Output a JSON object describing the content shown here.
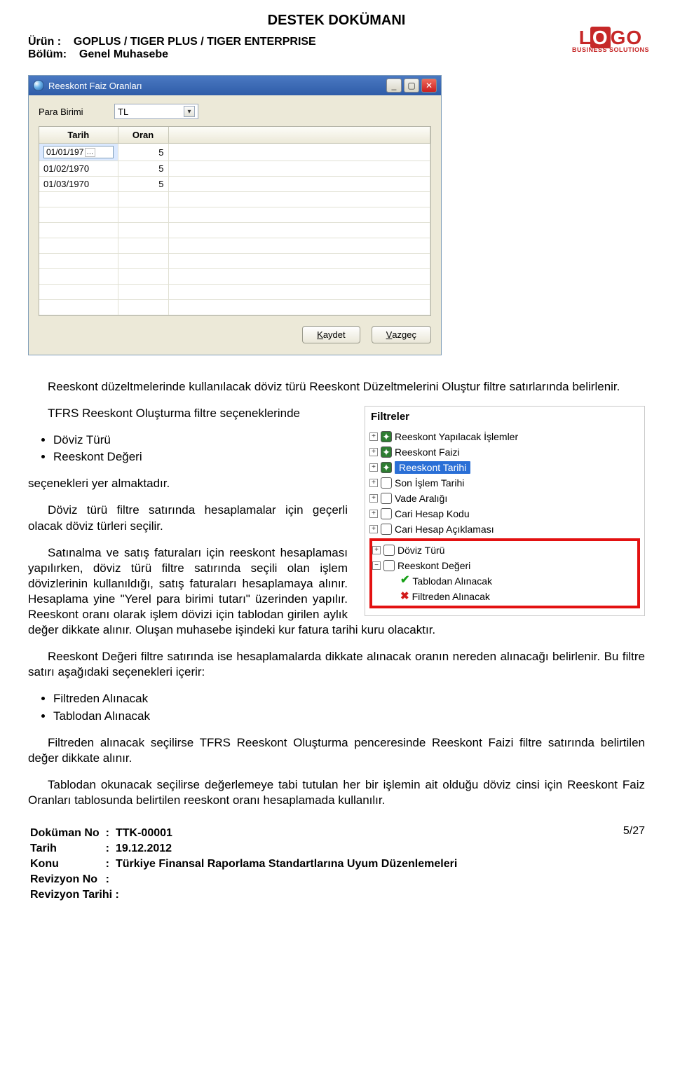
{
  "header": {
    "doc_title": "DESTEK DOKÜMANI",
    "product_label": "Ürün  :",
    "product_value": "GOPLUS / TIGER PLUS / TIGER ENTERPRISE",
    "section_label": "Bölüm:",
    "section_value": "Genel Muhasebe",
    "logo_text": "LOGO",
    "logo_sub": "BUSINESS SOLUTIONS"
  },
  "window": {
    "title": "Reeskont Faiz Oranları",
    "param_label": "Para Birimi",
    "param_value": "TL",
    "col1": "Tarih",
    "col2": "Oran",
    "rows": [
      {
        "date": "01/01/197",
        "rate": "5",
        "is_edit": true
      },
      {
        "date": "01/02/1970",
        "rate": "5",
        "is_edit": false
      },
      {
        "date": "01/03/1970",
        "rate": "5",
        "is_edit": false
      }
    ],
    "btn_save": "Kaydet",
    "btn_cancel": "Vazgeç"
  },
  "text": {
    "p1": "Reeskont düzeltmelerinde kullanılacak döviz türü Reeskont Düzeltmelerini Oluştur filtre satırlarında belirlenir.",
    "p2": "TFRS Reeskont Oluşturma filtre seçeneklerinde",
    "b1a": "Döviz Türü",
    "b1b": "Reeskont Değeri",
    "p3": "seçenekleri yer almaktadır.",
    "p4": "Döviz türü filtre satırında hesaplamalar için geçerli olacak döviz türleri seçilir.",
    "p5": "Satınalma ve satış faturaları için reeskont hesaplaması yapılırken, döviz türü filtre satırında seçili olan işlem dövizlerinin kullanıldığı, satış faturaları hesaplamaya alınır. Hesaplama yine \"Yerel para birimi tutarı\" üzerinden yapılır. Reeskont oranı olarak işlem dövizi için tablodan girilen aylık değer dikkate alınır. Oluşan muhasebe işindeki kur fatura tarihi kuru olacaktır.",
    "p6": "Reeskont Değeri filtre satırında ise hesaplamalarda dikkate alınacak oranın nereden alınacağı belirlenir. Bu filtre satırı aşağıdaki seçenekleri içerir:",
    "b2a": "Filtreden Alınacak",
    "b2b": "Tablodan Alınacak",
    "p7": "Filtreden alınacak seçilirse TFRS Reeskont Oluşturma penceresinde Reeskont Faizi filtre satırında belirtilen değer dikkate alınır.",
    "p8": "Tablodan okunacak seçilirse değerlemeye tabi tutulan her bir işlemin ait olduğu döviz cinsi için Reeskont Faiz Oranları tablosunda belirtilen reeskont oranı hesaplamada kullanılır."
  },
  "filter": {
    "title": "Filtreler",
    "items_top": [
      "Reeskont Yapılacak İşlemler",
      "Reeskont Faizi",
      "Reeskont Tarihi",
      "Son İşlem Tarihi",
      "Vade Aralığı",
      "Cari Hesap Kodu",
      "Cari Hesap Açıklaması"
    ],
    "items_box": [
      "Döviz Türü",
      "Reeskont Değeri"
    ],
    "sub_ok": "Tablodan Alınacak",
    "sub_no": "Filtreden Alınacak"
  },
  "footer": {
    "docno_label": "Doküman No",
    "docno_value": "TTK-00001",
    "date_label": "Tarih",
    "date_value": "19.12.2012",
    "topic_label": "Konu",
    "topic_value": "Türkiye Finansal Raporlama Standartlarına Uyum Düzenlemeleri",
    "revno_label": "Revizyon No",
    "revdate_label": "Revizyon Tarihi :",
    "page": "5/27"
  }
}
